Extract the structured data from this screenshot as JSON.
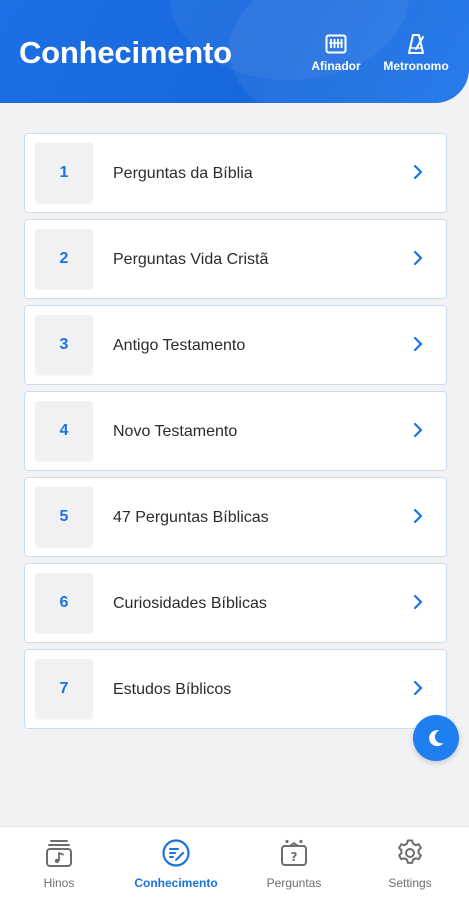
{
  "header": {
    "title": "Conhecimento",
    "actions": [
      {
        "label": "Afinador",
        "icon": "tuner-icon"
      },
      {
        "label": "Metronomo",
        "icon": "metronome-icon"
      }
    ]
  },
  "list": {
    "items": [
      {
        "number": "1",
        "label": "Perguntas da Bíblia"
      },
      {
        "number": "2",
        "label": "Perguntas Vida Cristã"
      },
      {
        "number": "3",
        "label": "Antigo Testamento"
      },
      {
        "number": "4",
        "label": "Novo Testamento"
      },
      {
        "number": "5",
        "label": "47 Perguntas Bíblicas"
      },
      {
        "number": "6",
        "label": "Curiosidades Bíblicas"
      },
      {
        "number": "7",
        "label": "Estudos Bíblicos"
      }
    ]
  },
  "fab": {
    "icon": "moon-icon"
  },
  "bottom_nav": {
    "items": [
      {
        "label": "Hinos",
        "icon": "hymnbook-icon",
        "active": false
      },
      {
        "label": "Conhecimento",
        "icon": "knowledge-icon",
        "active": true
      },
      {
        "label": "Perguntas",
        "icon": "question-book-icon",
        "active": false
      },
      {
        "label": "Settings",
        "icon": "gear-icon",
        "active": false
      }
    ]
  },
  "colors": {
    "accent": "#1a73e2",
    "header": "#1868dd",
    "background": "#f2f2f4",
    "card_border": "#c9dcf2",
    "inactive": "#6d6d6d"
  }
}
